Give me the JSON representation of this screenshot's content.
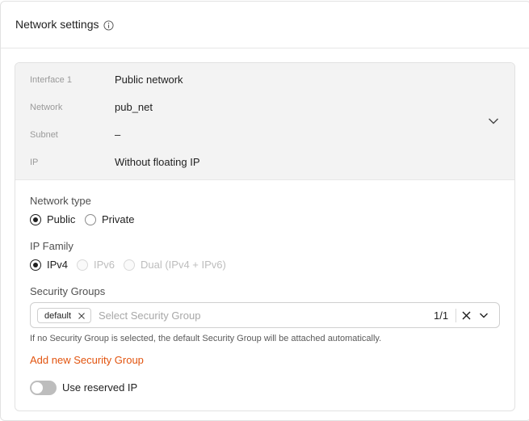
{
  "header": {
    "title": "Network settings",
    "info_icon": "info-icon"
  },
  "summary": {
    "rows": [
      {
        "label": "Interface 1",
        "value": "Public network"
      },
      {
        "label": "Network",
        "value": "pub_net"
      },
      {
        "label": "Subnet",
        "value": "–"
      },
      {
        "label": "IP",
        "value": "Without floating IP"
      }
    ],
    "expand_icon": "chevron-down-icon"
  },
  "network_type": {
    "label": "Network type",
    "options": [
      {
        "label": "Public",
        "checked": true,
        "disabled": false
      },
      {
        "label": "Private",
        "checked": false,
        "disabled": false
      }
    ]
  },
  "ip_family": {
    "label": "IP Family",
    "options": [
      {
        "label": "IPv4",
        "checked": true,
        "disabled": false
      },
      {
        "label": "IPv6",
        "checked": false,
        "disabled": true
      },
      {
        "label": "Dual (IPv4 + IPv6)",
        "checked": false,
        "disabled": true
      }
    ]
  },
  "security_groups": {
    "label": "Security Groups",
    "selected_tags": [
      "default"
    ],
    "placeholder": "Select Security Group",
    "count": "1/1",
    "helper": "If no Security Group is selected, the default Security Group will be attached automatically.",
    "add_link": "Add new Security Group"
  },
  "reserved_ip": {
    "label": "Use reserved IP",
    "enabled": false
  },
  "colors": {
    "accent": "#e2540f",
    "summary_bg": "#f3f3f3"
  }
}
